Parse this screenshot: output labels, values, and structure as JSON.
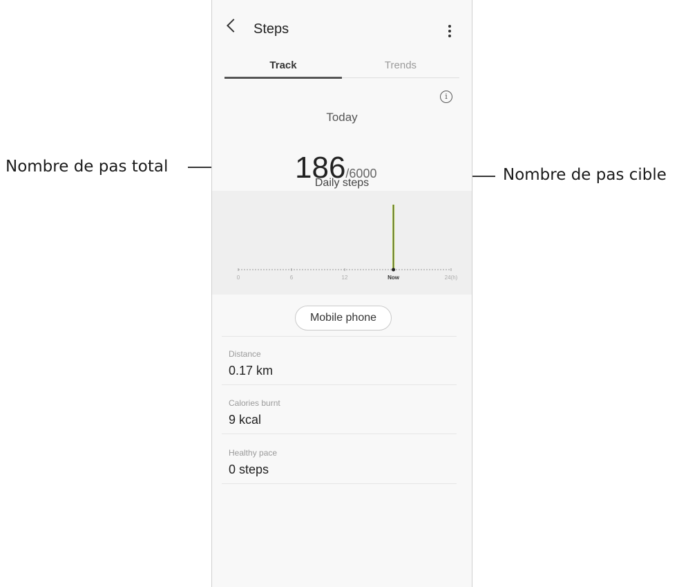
{
  "callouts": {
    "left": "Nombre de pas total",
    "right": "Nombre de pas cible"
  },
  "appbar": {
    "title": "Steps",
    "back_icon": "chevron-left-icon",
    "menu_icon": "more-vertical-icon"
  },
  "tabs": [
    {
      "label": "Track",
      "active": true
    },
    {
      "label": "Trends",
      "active": false
    }
  ],
  "info_icon": "info-icon",
  "summary": {
    "day_label": "Today",
    "steps": "186",
    "goal": "/6000",
    "caption": "Daily steps"
  },
  "chart_data": {
    "type": "bar",
    "x_ticks": [
      "0",
      "6",
      "12",
      "Now",
      "24(h)"
    ],
    "now_hour": 17.5,
    "bar": {
      "hour": 17.5,
      "relative_height": 1.0
    },
    "bar_color": "#a6c43b",
    "xlim": [
      0,
      24
    ]
  },
  "device_button": "Mobile phone",
  "stats": [
    {
      "label": "Distance",
      "value": "0.17 km"
    },
    {
      "label": "Calories burnt",
      "value": "9 kcal"
    },
    {
      "label": "Healthy pace",
      "value": "0 steps"
    }
  ]
}
